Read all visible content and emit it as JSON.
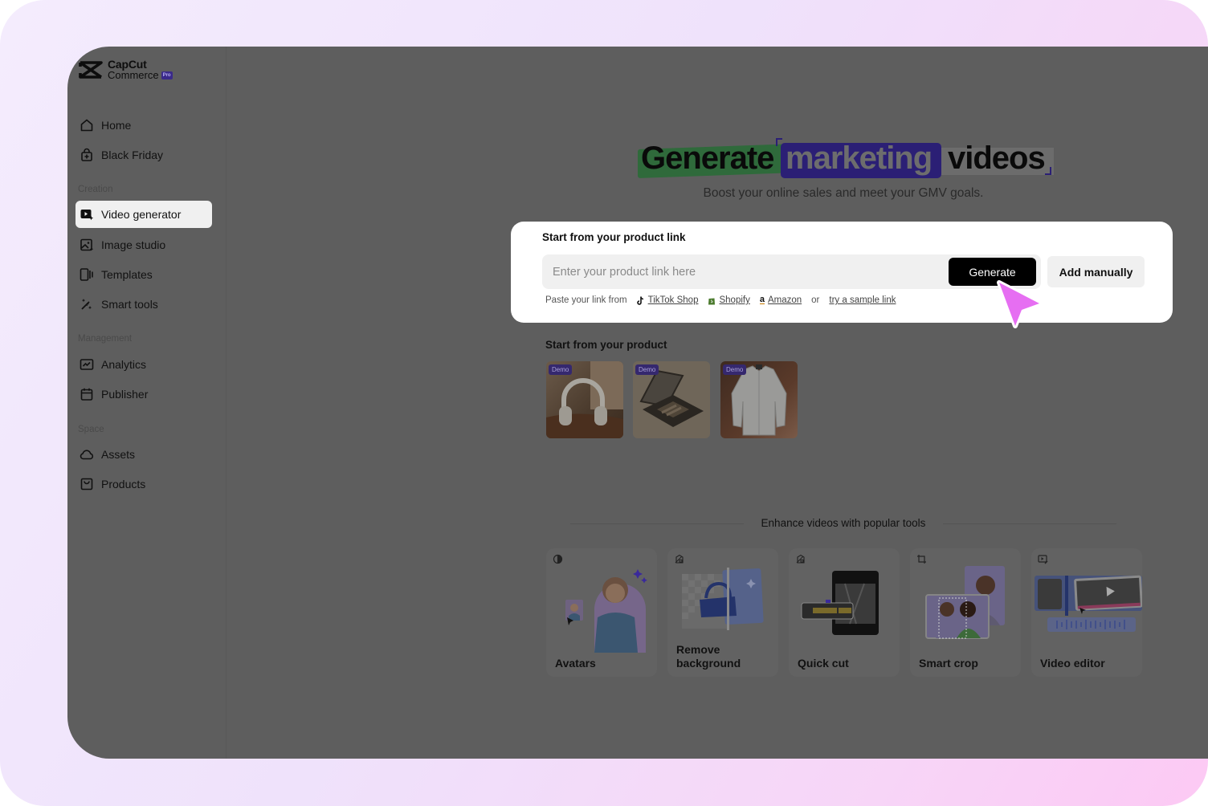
{
  "brand": {
    "name_line1": "CapCut",
    "name_line2": "Commerce",
    "badge": "Pro"
  },
  "sidebar": {
    "items_top": [
      {
        "label": "Home",
        "icon": "home-icon"
      },
      {
        "label": "Black Friday",
        "icon": "shopping-bag-plus-icon"
      }
    ],
    "sections": [
      {
        "title": "Creation",
        "items": [
          {
            "label": "Video generator",
            "icon": "video-sparkle-icon",
            "active": true
          },
          {
            "label": "Image studio",
            "icon": "image-sparkle-icon"
          },
          {
            "label": "Templates",
            "icon": "templates-icon"
          },
          {
            "label": "Smart tools",
            "icon": "magic-wand-icon"
          }
        ]
      },
      {
        "title": "Management",
        "items": [
          {
            "label": "Analytics",
            "icon": "analytics-icon"
          },
          {
            "label": "Publisher",
            "icon": "calendar-icon"
          }
        ]
      },
      {
        "title": "Space",
        "items": [
          {
            "label": "Assets",
            "icon": "cloud-icon"
          },
          {
            "label": "Products",
            "icon": "product-box-icon"
          }
        ]
      }
    ]
  },
  "hero": {
    "title_word1": "Generate",
    "title_word2": "marketing",
    "title_word3": "videos",
    "subtitle": "Boost your online sales and meet your GMV goals."
  },
  "link_card": {
    "label": "Start from your product link",
    "input_value": "",
    "input_placeholder": "Enter your product link here",
    "generate_label": "Generate",
    "add_manually_label": "Add manually",
    "paste_prefix": "Paste your link from",
    "sources": [
      {
        "label": "TikTok Shop",
        "icon": "tiktok-icon"
      },
      {
        "label": "Shopify",
        "icon": "shopify-icon"
      },
      {
        "label": "Amazon",
        "icon": "amazon-icon"
      }
    ],
    "or_text": "or",
    "sample_link_label": "try a sample link"
  },
  "products": {
    "label": "Start from your product",
    "items": [
      {
        "badge": "Demo",
        "subject": "headphones"
      },
      {
        "badge": "Demo",
        "subject": "eyeshadow palette"
      },
      {
        "badge": "Demo",
        "subject": "white shirt"
      }
    ]
  },
  "tools": {
    "heading": "Enhance videos with popular tools",
    "items": [
      {
        "label": "Avatars",
        "icon": "avatar-icon"
      },
      {
        "label": "Remove background",
        "icon": "remove-background-icon"
      },
      {
        "label": "Quick cut",
        "icon": "quick-cut-icon"
      },
      {
        "label": "Smart crop",
        "icon": "crop-icon"
      },
      {
        "label": "Video editor",
        "icon": "video-edit-icon"
      }
    ]
  },
  "colors": {
    "overlay_gray": "#5e5e5e",
    "accent_purple": "#2b1f75",
    "accent_green": "#2f6a3b",
    "cursor_pink": "#e66ef2"
  }
}
